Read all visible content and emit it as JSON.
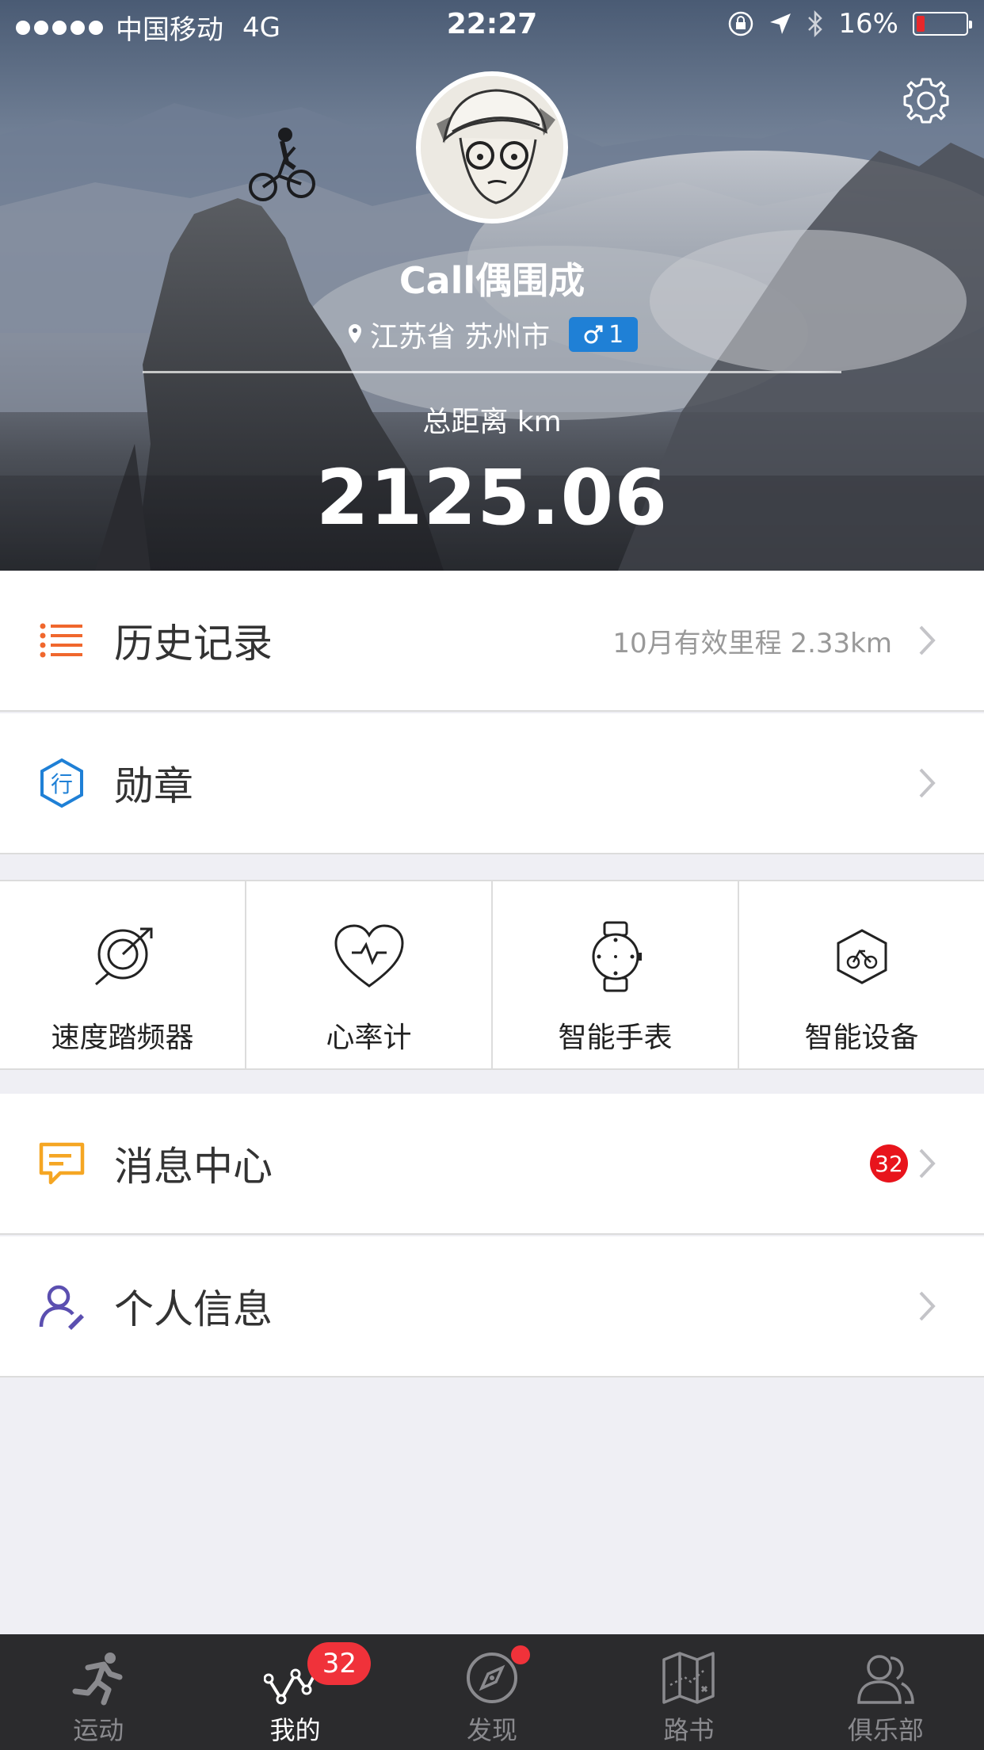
{
  "status_bar": {
    "carrier": "中国移动",
    "network": "4G",
    "time": "22:27",
    "battery": "16%",
    "battery_level": 0.16
  },
  "profile": {
    "username": "Call偶围成",
    "location": "江苏省 苏州市",
    "level": "1",
    "total_label": "总距离 km",
    "total_distance": "2125.06"
  },
  "rows": {
    "history": {
      "title": "历史记录",
      "detail": "10月有效里程 2.33km"
    },
    "medals": {
      "title": "勋章",
      "icon_text": "行"
    },
    "messages": {
      "title": "消息中心",
      "badge": "32"
    },
    "personal": {
      "title": "个人信息"
    }
  },
  "devices": [
    {
      "label": "速度踏频器",
      "icon": "speed-cadence-sensor-icon"
    },
    {
      "label": "心率计",
      "icon": "heart-rate-icon"
    },
    {
      "label": "智能手表",
      "icon": "smart-watch-icon"
    },
    {
      "label": "智能设备",
      "icon": "smart-device-icon"
    }
  ],
  "tabs": [
    {
      "label": "运动",
      "icon": "runner-icon"
    },
    {
      "label": "我的",
      "icon": "my-chart-icon",
      "badge": "32",
      "active": true
    },
    {
      "label": "发现",
      "icon": "compass-icon"
    },
    {
      "label": "路书",
      "icon": "map-icon"
    },
    {
      "label": "俱乐部",
      "icon": "club-icon"
    }
  ],
  "colors": {
    "accent_orange": "#f0672d",
    "medal_blue": "#1f80d6",
    "message_yellow": "#f5a623",
    "personal_purple": "#5b4fb0",
    "badge_red": "#e8141c",
    "tabbar_bg": "#2b2b2d"
  }
}
